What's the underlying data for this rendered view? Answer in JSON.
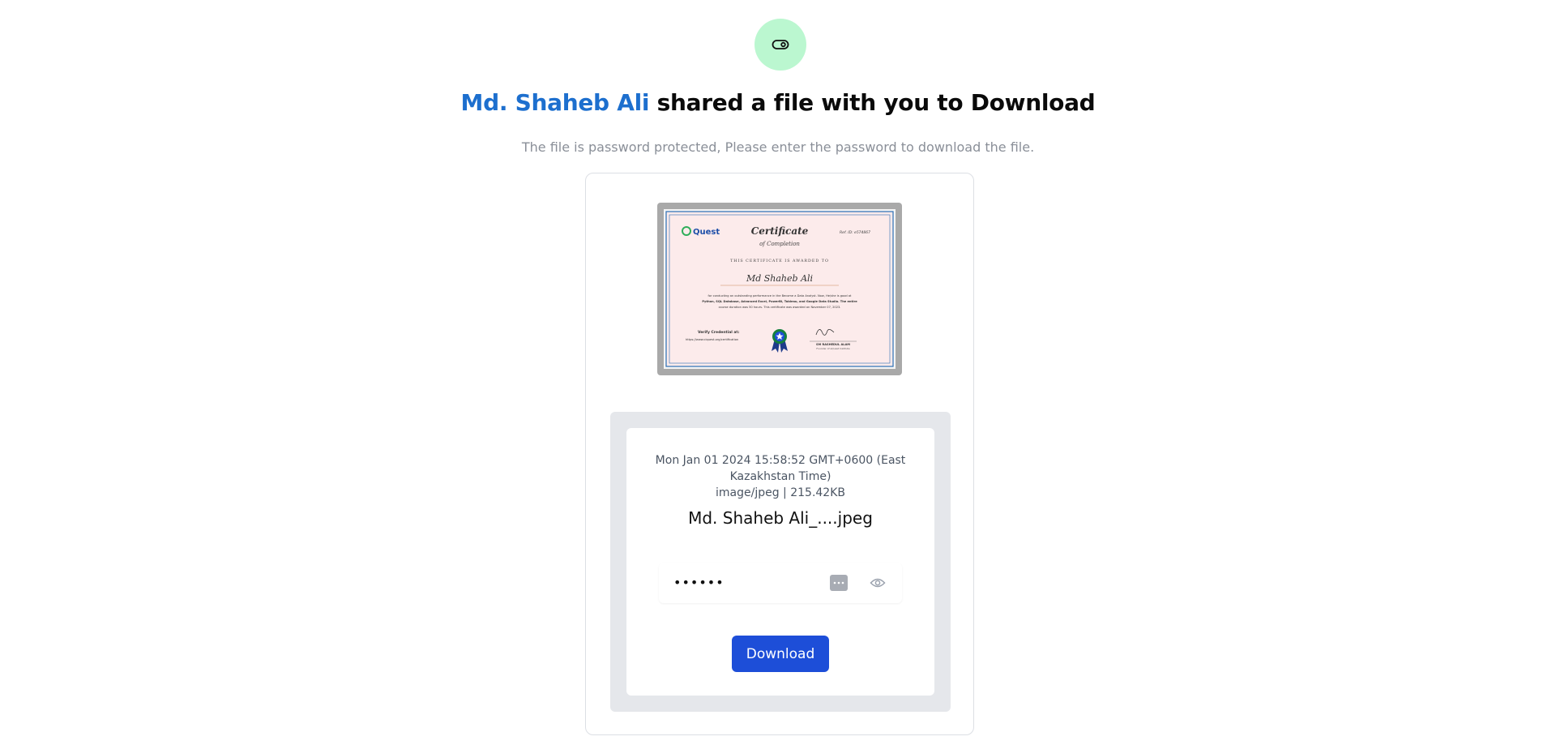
{
  "header": {
    "icon": "toggle-icon",
    "icon_bg_color": "#bbf7d0",
    "sender_name": "Md. Shaheb Ali",
    "title_suffix": " shared a file with you to Download",
    "subtitle": "The file is password protected, Please enter the password to download the file.",
    "accent_color": "#1d6fce"
  },
  "preview": {
    "brand": "Quest",
    "title": "Certificate",
    "subtitle": "of Completion",
    "ref": "Ref. ID: e574867",
    "awarded_to": "THIS CERTIFICATE IS AWARDED TO",
    "recipient": "Md Shaheb Ali",
    "body_line1": "for conducting an outstanding performance in the Become a Data Analyst. Now, He/she is good at",
    "body_line2": "Python, SQL Database, Advanced Excel, PowerBI, Tableau, and Google Data Studio. The entire",
    "body_line3": "course duration was 50 hours. This certificate was awarded on November 07, 2023.",
    "verify_label": "Verify Credential at:",
    "verify_url": "https://www.ciquest.org/certification",
    "signer_name": "SM RASHEDUL ALAM",
    "signer_title": "Founder of eQuest Institute"
  },
  "file": {
    "date": "Mon Jan 01 2024 15:58:52 GMT+0600 (East Kazakhstan Time)",
    "type_size": "image/jpeg | 215.42KB",
    "name": "Md. Shaheb Ali_....jpeg"
  },
  "password": {
    "value": "••••••",
    "manager_icon": "password-manager-icon",
    "toggle_icon": "eye-icon"
  },
  "actions": {
    "download_label": "Download",
    "button_color": "#1d4ed8"
  }
}
